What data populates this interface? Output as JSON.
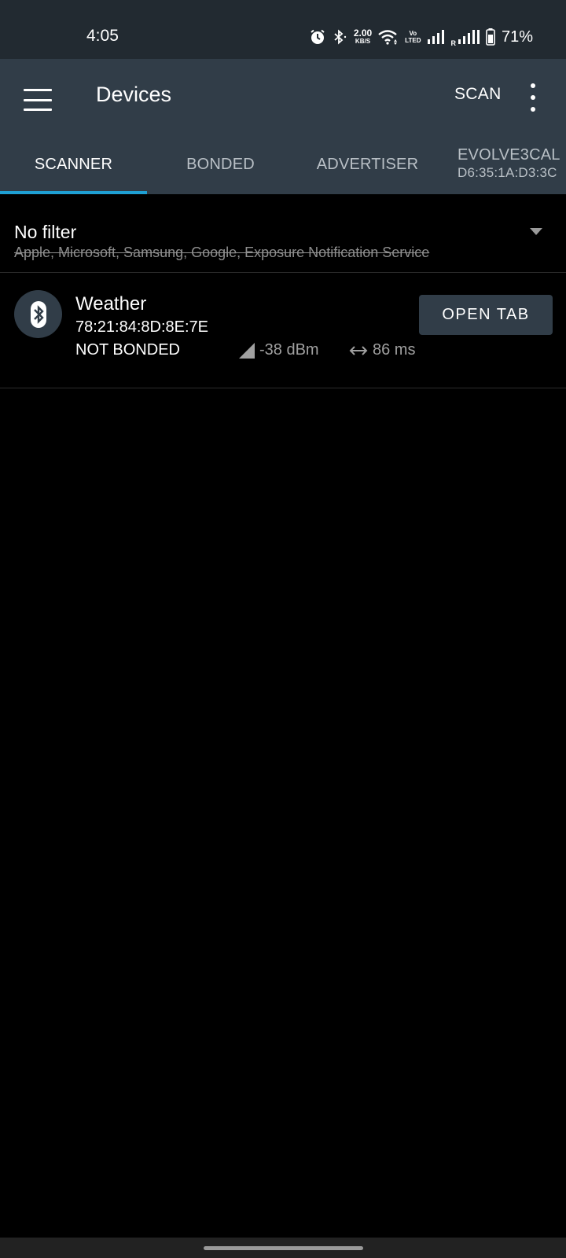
{
  "status_bar": {
    "time": "4:05",
    "net_speed_value": "2.00",
    "net_speed_unit": "KB/S",
    "volte_top": "Vo",
    "volte_bottom": "LTED",
    "roaming": "R",
    "battery": "71%",
    "icons": [
      "alarm-icon",
      "bluetooth-icon",
      "wifi-icon",
      "signal-icon",
      "signal-roaming-icon",
      "battery-icon"
    ]
  },
  "app_bar": {
    "title": "Devices",
    "scan_label": "SCAN",
    "icons": [
      "menu-icon",
      "overflow-icon"
    ],
    "background": "#313d48"
  },
  "tabs": {
    "scanner": "SCANNER",
    "bonded": "BONDED",
    "advertiser": "ADVERTISER",
    "device_name": "EVOLVE3CAL",
    "device_address": "D6:35:1A:D3:3C",
    "active": "SCANNER",
    "indicator_color": "#1fa0d4"
  },
  "filter": {
    "title": "No filter",
    "excluded": "Apple, Microsoft, Samsung, Google, Exposure Notification Service"
  },
  "devices": [
    {
      "name": "Weather",
      "address": "78:21:84:8D:8E:7E",
      "bond_state": "NOT BONDED",
      "rssi": "-38 dBm",
      "interval": "86 ms",
      "action": "OPEN TAB",
      "icon": "bluetooth-icon"
    }
  ]
}
